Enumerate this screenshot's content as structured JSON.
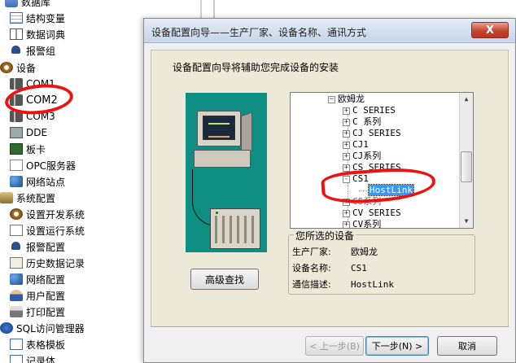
{
  "left_tree": {
    "items": [
      {
        "label": "数据库",
        "icon": "database-icon"
      },
      {
        "label": "结构变量",
        "icon": "table-icon"
      },
      {
        "label": "数据词典",
        "icon": "book-icon"
      },
      {
        "label": "报警组",
        "icon": "alarm-icon"
      },
      {
        "label": "设备",
        "icon": "device-icon"
      },
      {
        "label": "COM1",
        "icon": "serial-port-icon"
      },
      {
        "label": "COM2",
        "icon": "serial-port-icon"
      },
      {
        "label": "COM3",
        "icon": "serial-port-icon"
      },
      {
        "label": "DDE",
        "icon": "dde-icon"
      },
      {
        "label": "板卡",
        "icon": "card-icon"
      },
      {
        "label": "OPC服务器",
        "icon": "opc-icon"
      },
      {
        "label": "网络站点",
        "icon": "network-icon"
      },
      {
        "label": "系统配置",
        "icon": "system-icon"
      },
      {
        "label": "设置开发系统",
        "icon": "settings-icon"
      },
      {
        "label": "设置运行系统",
        "icon": "run-icon"
      },
      {
        "label": "报警配置",
        "icon": "alarm-icon"
      },
      {
        "label": "历史数据记录",
        "icon": "history-icon"
      },
      {
        "label": "网络配置",
        "icon": "network-icon"
      },
      {
        "label": "用户配置",
        "icon": "user-icon"
      },
      {
        "label": "打印配置",
        "icon": "printer-icon"
      },
      {
        "label": "SQL访问管理器",
        "icon": "sql-icon"
      },
      {
        "label": "表格模板",
        "icon": "form-icon"
      },
      {
        "label": "记录体",
        "icon": "form-icon"
      }
    ]
  },
  "dialog": {
    "title": "设备配置向导——生产厂家、设备名称、通讯方式",
    "close_label": "X",
    "intro": "设备配置向导将辅助您完成设备的安装",
    "advanced_search_label": "高级查找",
    "device_tree": {
      "root": "欧姆龙",
      "nodes": [
        {
          "label": "C SERIES",
          "expander": "+"
        },
        {
          "label": "C 系列",
          "expander": "+"
        },
        {
          "label": "CJ SERIES",
          "expander": "+"
        },
        {
          "label": "CJ1",
          "expander": "+"
        },
        {
          "label": "CJ系列",
          "expander": "+"
        },
        {
          "label": "CS SERIES",
          "expander": "+"
        },
        {
          "label": "CS1",
          "expander": "-"
        },
        {
          "label": "HostLink",
          "expander": ""
        },
        {
          "label": "CS系列",
          "expander": "+"
        },
        {
          "label": "CV SERIES",
          "expander": "+"
        },
        {
          "label": "CV系列",
          "expander": "+"
        }
      ]
    },
    "selected_device": {
      "group_title": "您所选的设备",
      "manufacturer_label": "生产厂家:",
      "manufacturer_value": "欧姆龙",
      "device_name_label": "设备名称:",
      "device_name_value": "CS1",
      "comm_label": "通信描述:",
      "comm_value": "HostLink"
    },
    "buttons": {
      "prev": "< 上一步(B)",
      "next": "下一步(N) >",
      "cancel": "取消"
    }
  },
  "colors": {
    "annotation_red": "#ee1111",
    "illustration_bg": "#0f8f84",
    "selection_blue": "#3399ff"
  }
}
